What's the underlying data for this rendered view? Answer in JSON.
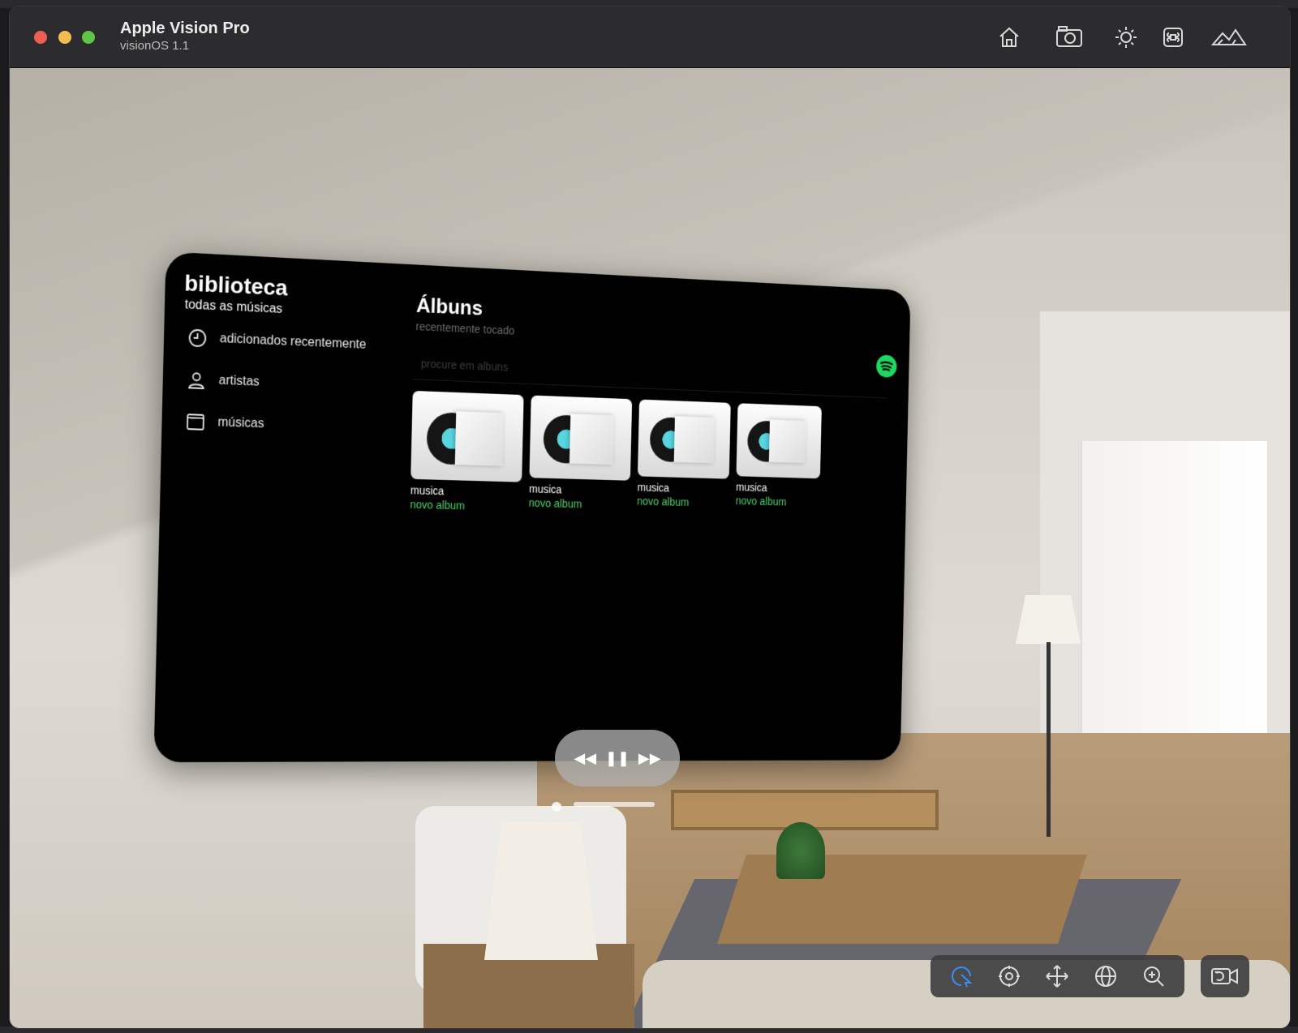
{
  "window": {
    "title": "Apple Vision Pro",
    "subtitle": "visionOS 1.1",
    "toolbar_icons": [
      "home-icon",
      "camera-icon",
      "brightness-icon",
      "command-icon",
      "environment-icon"
    ]
  },
  "sidebar": {
    "title": "biblioteca",
    "subtitle": "todas as músicas",
    "items": [
      {
        "label": "adicionados recentemente",
        "icon": "clock-icon"
      },
      {
        "label": "artistas",
        "icon": "person-icon"
      },
      {
        "label": "músicas",
        "icon": "folder-icon"
      }
    ]
  },
  "main": {
    "title": "Álbuns",
    "subtitle": "recentemente tocado",
    "search": {
      "placeholder": "procure em albuns",
      "value": ""
    },
    "albums": [
      {
        "name": "musica",
        "artist": "novo album"
      },
      {
        "name": "musica",
        "artist": "novo album"
      },
      {
        "name": "musica",
        "artist": "novo album"
      },
      {
        "name": "musica",
        "artist": "novo album"
      }
    ],
    "brand_icon": "spotify-icon",
    "accent_color": "#4bd46b"
  },
  "player": {
    "controls": [
      "backward-icon",
      "pause-icon",
      "forward-icon"
    ],
    "backward": "◀◀",
    "pause": "❚❚",
    "forward": "▶▶"
  },
  "bottom_toolbar": {
    "tools": [
      "select-icon",
      "look-icon",
      "move-icon",
      "orbit-icon",
      "zoom-icon"
    ],
    "active": "select-icon",
    "camera": "camera-reset-icon"
  }
}
